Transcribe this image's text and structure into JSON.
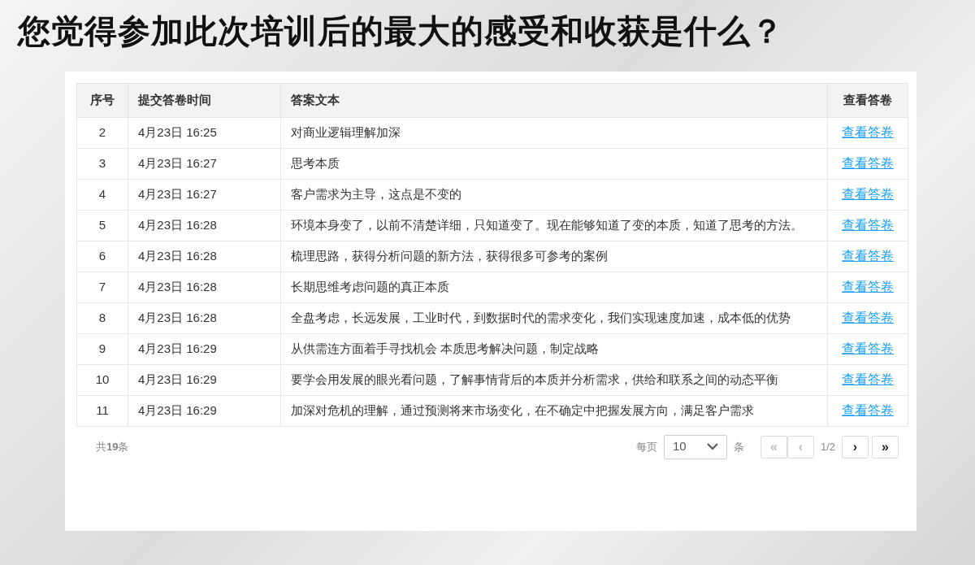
{
  "title": "您觉得参加此次培训后的最大的感受和收获是什么？",
  "table": {
    "columns": [
      "序号",
      "提交答卷时间",
      "答案文本",
      "查看答卷"
    ],
    "rows": [
      {
        "no": "2",
        "time": "4月23日 16:25",
        "answer": "对商业逻辑理解加深",
        "link": "查看答卷"
      },
      {
        "no": "3",
        "time": "4月23日 16:27",
        "answer": "思考本质",
        "link": "查看答卷"
      },
      {
        "no": "4",
        "time": "4月23日 16:27",
        "answer": "客户需求为主导，这点是不变的",
        "link": "查看答卷"
      },
      {
        "no": "5",
        "time": "4月23日 16:28",
        "answer": "环境本身变了，以前不清楚详细，只知道变了。现在能够知道了变的本质，知道了思考的方法。",
        "link": "查看答卷"
      },
      {
        "no": "6",
        "time": "4月23日 16:28",
        "answer": "梳理思路，获得分析问题的新方法，获得很多可参考的案例",
        "link": "查看答卷"
      },
      {
        "no": "7",
        "time": "4月23日 16:28",
        "answer": "长期思维考虑问题的真正本质",
        "link": "查看答卷"
      },
      {
        "no": "8",
        "time": "4月23日 16:28",
        "answer": "全盘考虑，长远发展，工业时代，到数据时代的需求变化，我们实现速度加速，成本低的优势",
        "link": "查看答卷"
      },
      {
        "no": "9",
        "time": "4月23日 16:29",
        "answer": "从供需连方面着手寻找机会 本质思考解决问题，制定战略",
        "link": "查看答卷"
      },
      {
        "no": "10",
        "time": "4月23日 16:29",
        "answer": "要学会用发展的眼光看问题，了解事情背后的本质并分析需求，供给和联系之间的动态平衡",
        "link": "查看答卷"
      },
      {
        "no": "11",
        "time": "4月23日 16:29",
        "answer": "加深对危机的理解，通过预测将来市场变化，在不确定中把握发展方向，满足客户需求",
        "link": "查看答卷"
      }
    ]
  },
  "footer": {
    "total": "共**19**条",
    "per_page_label": "每页",
    "per_page_value": "10",
    "per_page_unit": "条",
    "pager": [
      {
        "kind": "first",
        "label": "«",
        "disabled": true
      },
      {
        "kind": "prev",
        "label": "‹",
        "disabled": true
      },
      {
        "kind": "page",
        "label": "1/2"
      },
      {
        "kind": "next",
        "label": "›",
        "disabled": false
      },
      {
        "kind": "last",
        "label": "»",
        "disabled": false
      }
    ]
  }
}
